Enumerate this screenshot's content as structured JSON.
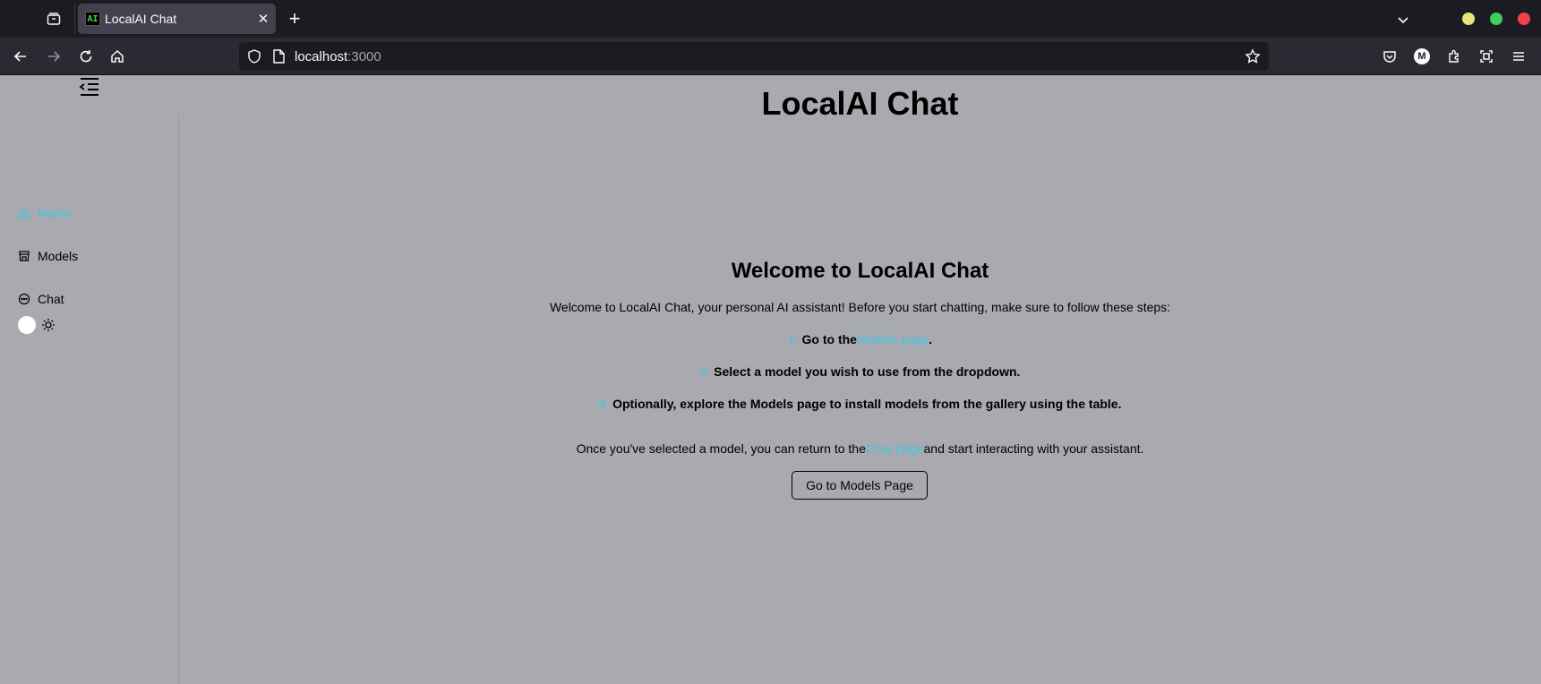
{
  "browser": {
    "tab_title": "LocalAI Chat",
    "favicon_text": "AI",
    "url_host": "localhost",
    "url_port": ":3000",
    "account_initial": "M"
  },
  "sidebar": {
    "items": [
      {
        "label": "Home",
        "icon": "home-icon",
        "active": true
      },
      {
        "label": "Models",
        "icon": "store-icon",
        "active": false
      },
      {
        "label": "Chat",
        "icon": "chat-bubble-icon",
        "active": false
      }
    ]
  },
  "main": {
    "app_title": "LocalAI Chat",
    "welcome_title": "Welcome to LocalAI Chat",
    "intro": "Welcome to LocalAI Chat, your personal AI assistant! Before you start chatting, make sure to follow these steps:",
    "steps": [
      {
        "num": "1.",
        "before": "Go to the",
        "link": "Models page",
        "after": "."
      },
      {
        "num": "2.",
        "text": "Select a model you wish to use from the dropdown."
      },
      {
        "num": "3.",
        "text": "Optionally, explore the Models page to install models from the gallery using the table."
      }
    ],
    "outro_before": "Once you've selected a model, you can return to the",
    "outro_link": "Chat page",
    "outro_after": "and start interacting with your assistant.",
    "cta_label": "Go to Models Page"
  },
  "colors": {
    "accent": "#3fc6e3",
    "page_bg": "#a9aaaf",
    "chrome_bg": "#1c1b22"
  }
}
